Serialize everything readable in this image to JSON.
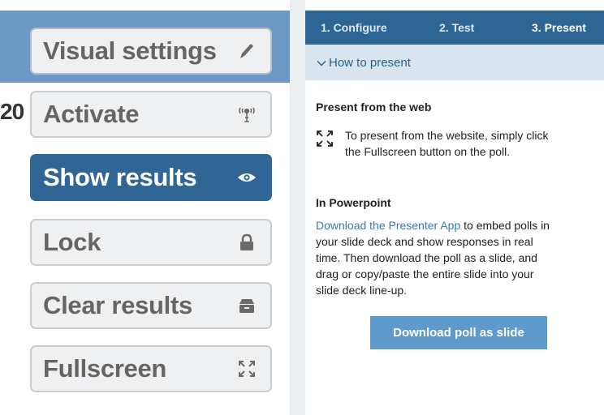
{
  "left": {
    "peek_text": "20",
    "buttons": [
      {
        "label": "Visual settings",
        "icon": "pencil-icon"
      },
      {
        "label": "Activate",
        "icon": "antenna-icon"
      },
      {
        "label": "Show results",
        "icon": "eye-icon"
      },
      {
        "label": "Lock",
        "icon": "lock-icon"
      },
      {
        "label": "Clear results",
        "icon": "archive-icon"
      },
      {
        "label": "Fullscreen",
        "icon": "fullscreen-icon"
      }
    ]
  },
  "tabs": [
    {
      "label": "1. Configure"
    },
    {
      "label": "2. Test"
    },
    {
      "label": "3. Present"
    }
  ],
  "accordion": {
    "title": "How to present"
  },
  "web": {
    "heading": "Present from the web",
    "text_line1": "To present from the website, simply click",
    "text_line2": "the Fullscreen button on the poll."
  },
  "powerpoint": {
    "heading": "In Powerpoint",
    "link_text": "Download the Presenter App",
    "text_after_link": " to embed polls in",
    "line2": "your slide deck and show responses in real",
    "line3": "time. Then download the poll as a slide, and",
    "line4": "drag or copy/paste the entire slide into your",
    "line5": "slide deck line-up."
  },
  "download_button": {
    "label": "Download poll as slide"
  },
  "colors": {
    "tab_bar": "#2d6695",
    "accordion_bg": "#d9e4ef",
    "active_button": "#2f6696",
    "download_button": "#5e9acb",
    "link": "#3a79b5"
  }
}
